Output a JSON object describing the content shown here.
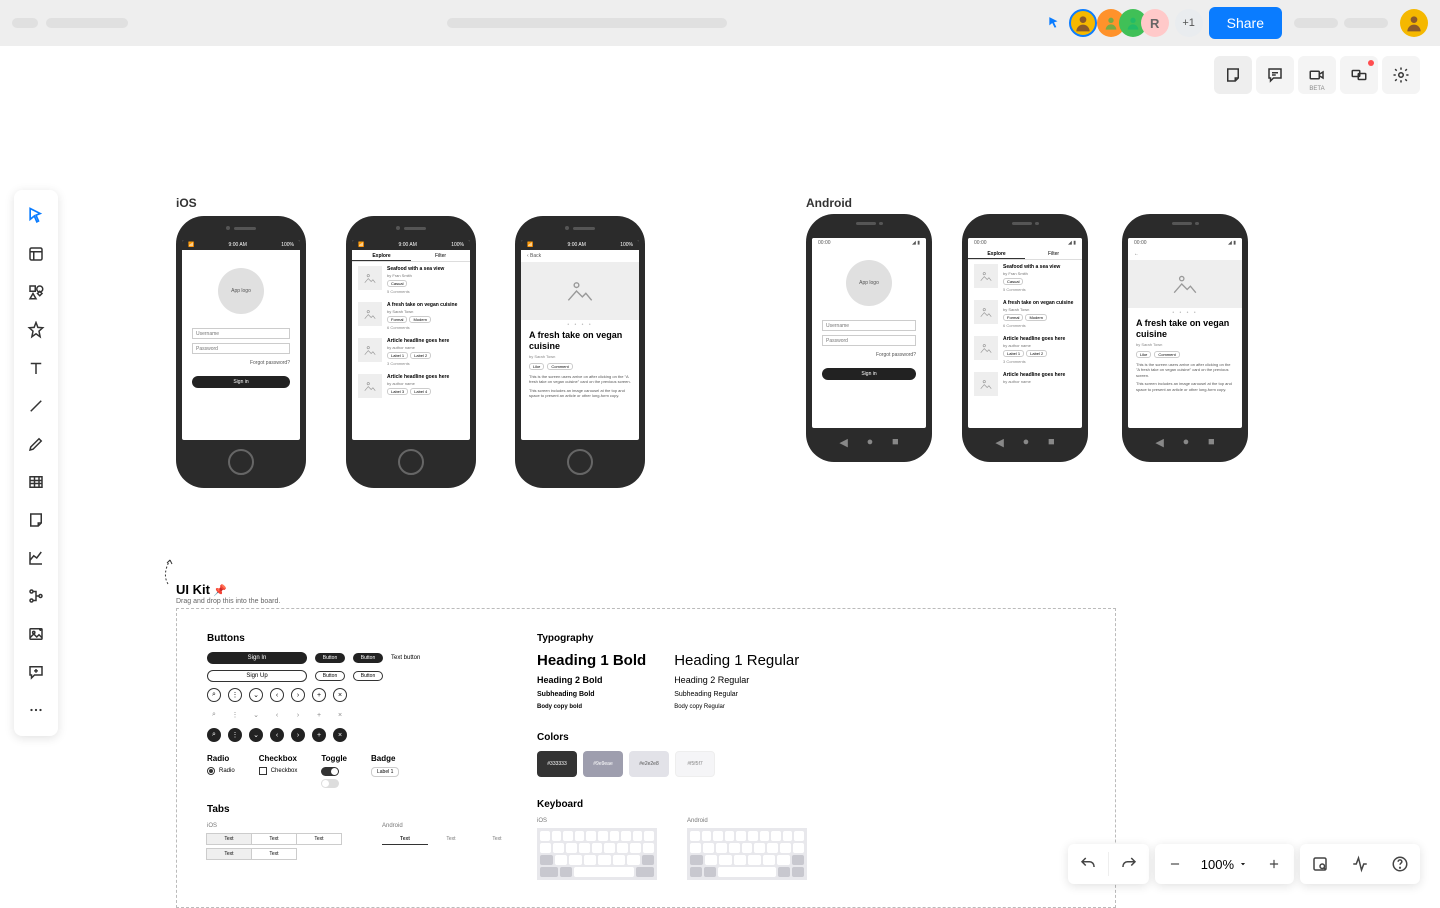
{
  "topbar": {
    "share_label": "Share",
    "more_avatars": "+1",
    "avatar_initial": "R"
  },
  "sections": {
    "ios": "iOS",
    "android": "Android"
  },
  "login": {
    "logo": "App logo",
    "username": "Username",
    "password": "Password",
    "forgot": "Forgot password?",
    "signin": "Sign in"
  },
  "status": {
    "time": "9:00 AM",
    "carrier_ios": "100%",
    "android_left": "00:00"
  },
  "feed": {
    "tab_explore": "Explore",
    "tab_filter": "Filter",
    "items": [
      {
        "title": "Seafood with a sea view",
        "by": "by Fran Smith",
        "tag1": "Casual",
        "comments": "5 Comments"
      },
      {
        "title": "A fresh take on vegan cuisine",
        "by": "by Sarah Town",
        "tag1": "Formal",
        "tag2": "Modern",
        "comments": "6 Comments"
      },
      {
        "title": "Article headline goes here",
        "by": "by author name",
        "tag1": "Label 1",
        "tag2": "Label 2",
        "comments": "3 Comments"
      },
      {
        "title": "Article headline goes here",
        "by": "by author name",
        "tag1": "Label 3",
        "tag2": "Label 4",
        "comments": ""
      }
    ]
  },
  "detail": {
    "back": "‹  Back",
    "title": "A fresh take on vegan cuisine",
    "by": "by Sarah Town",
    "like": "Like",
    "comment": "Comment",
    "p1": "This is the screen users arrive on after clicking on the \"A fresh take on vegan cuisine\" card on the previous screen.",
    "p2": "This screen includes an image carousel at the top and space to present an article or other long-form copy."
  },
  "uikit": {
    "title": "UI Kit",
    "sub": "Drag and drop this into the board.",
    "pin": "📌",
    "buttons_h": "Buttons",
    "btn_signin": "Sign In",
    "btn_signup": "Sign Up",
    "btn_button": "Button",
    "btn_text": "Text button",
    "radio_h": "Radio",
    "radio_lbl": "Radio",
    "checkbox_h": "Checkbox",
    "checkbox_lbl": "Checkbox",
    "toggle_h": "Toggle",
    "badge_h": "Badge",
    "badge_lbl": "Label 1",
    "tabs_h": "Tabs",
    "tabs_ios": "iOS",
    "tabs_android": "Android",
    "tab_txt": "Text",
    "typo_h": "Typography",
    "h1b": "Heading 1 Bold",
    "h1r": "Heading 1 Regular",
    "h2b": "Heading 2 Bold",
    "h2r": "Heading 2 Regular",
    "shb": "Subheading Bold",
    "shr": "Subheading Regular",
    "bcb": "Body copy bold",
    "bcr": "Body copy Regular",
    "colors_h": "Colors",
    "c1": "#333333",
    "c2": "#9e9eae",
    "c3": "#e2e2e8",
    "c4": "#f5f5f7",
    "keyboard_h": "Keyboard"
  },
  "rightTools": {
    "beta": "BETA"
  },
  "zoom": {
    "value": "100%"
  }
}
